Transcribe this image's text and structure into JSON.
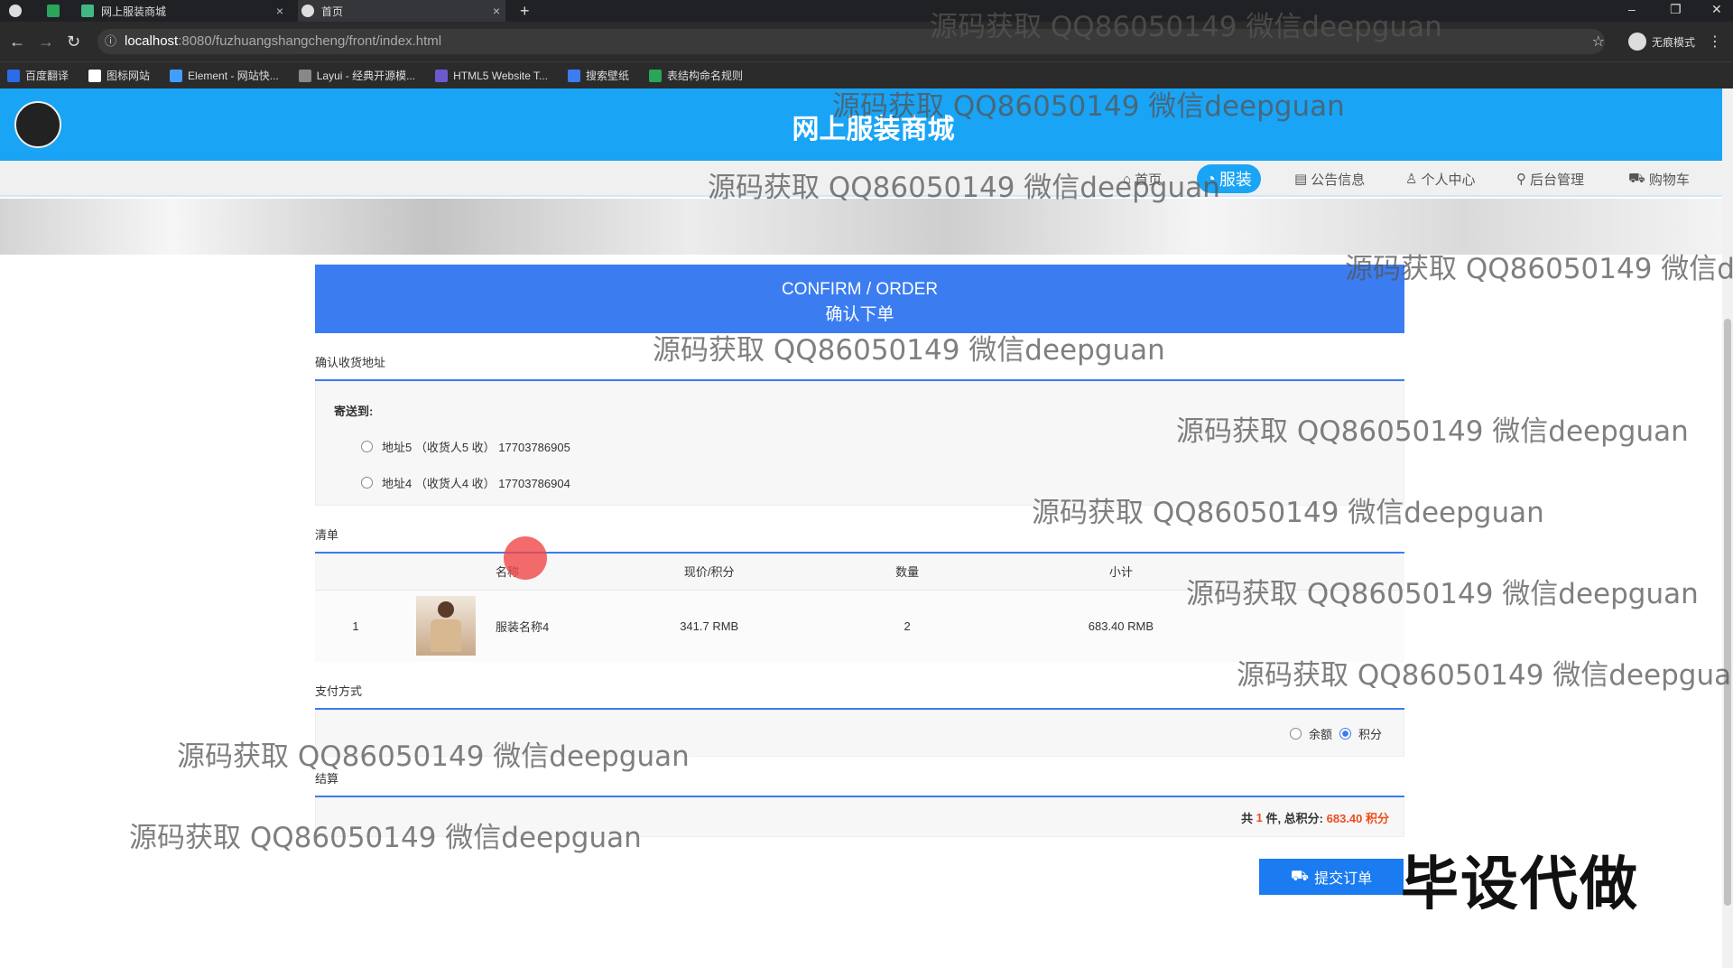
{
  "browser": {
    "tabs": [
      {
        "title": "网上服装商城"
      },
      {
        "title": "首页"
      }
    ],
    "new_tab": "+",
    "url_host": "localhost",
    "url_path": ":8080/fuzhuangshangcheng/front/index.html",
    "incognito_label": "无痕模式",
    "bookmarks": [
      "百度翻译",
      "图标网站",
      "Element - 网站快...",
      "Layui - 经典开源模...",
      "HTML5 Website T...",
      "搜索壁纸",
      "表结构命名规则"
    ]
  },
  "site": {
    "title": "网上服装商城",
    "nav": [
      {
        "label": "首页",
        "icon": "home-icon",
        "active": false
      },
      {
        "label": "服装",
        "icon": "clothes-icon",
        "active": true
      },
      {
        "label": "公告信息",
        "icon": "notice-icon",
        "active": false
      },
      {
        "label": "个人中心",
        "icon": "user-icon",
        "active": false
      },
      {
        "label": "后台管理",
        "icon": "link-icon",
        "active": false
      },
      {
        "label": "购物车",
        "icon": "cart-icon",
        "active": false
      }
    ]
  },
  "order": {
    "header_en": "CONFIRM / ORDER",
    "header_cn": "确认下单",
    "address_section": "确认收货地址",
    "send_to": "寄送到:",
    "addresses": [
      {
        "text": "地址5 （收货人5 收） 17703786905",
        "selected": false
      },
      {
        "text": "地址4 （收货人4 收） 17703786904",
        "selected": false
      }
    ],
    "list_section": "清单",
    "columns": [
      "名称",
      "现价/积分",
      "数量",
      "小计"
    ],
    "items": [
      {
        "index": "1",
        "name": "服装名称4",
        "price": "341.7 RMB",
        "qty": "2",
        "subtotal": "683.40 RMB"
      }
    ],
    "payment_section": "支付方式",
    "payment_options": [
      {
        "label": "余额",
        "selected": false
      },
      {
        "label": "积分",
        "selected": true
      }
    ],
    "settle_section": "结算",
    "settle_prefix": "共",
    "settle_count": "1",
    "settle_mid": "件, 总积分:",
    "settle_total": "683.40 积分",
    "submit_label": "提交订单"
  },
  "overlay": {
    "watermark": "源码获取 QQ86050149 微信deepguan",
    "watermark_cut": "源码获取 QQ86050149 微信dee",
    "promo": "毕设代做"
  },
  "colors": {
    "header": "#1aa4f5",
    "accent": "#3b7df1",
    "total": "#f04c1c"
  }
}
